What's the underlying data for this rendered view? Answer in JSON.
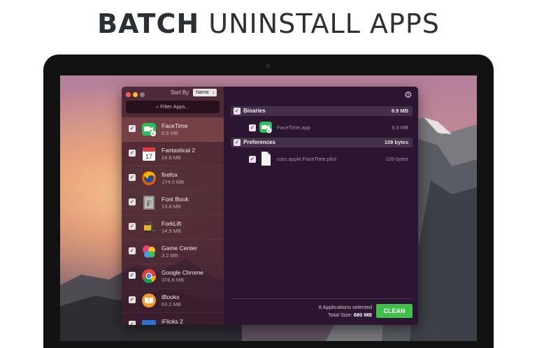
{
  "headline": {
    "bold": "BATCH",
    "rest": "UNINSTALL APPS"
  },
  "window": {
    "traffic_colors": [
      "#ff5f57",
      "#febc2e",
      "#8a7a80"
    ],
    "sort_label": "Sort By",
    "sort_value": "Name",
    "filter_placeholder": "Filter Apps..."
  },
  "apps": [
    {
      "name": "FaceTime",
      "size": "8.9 MB",
      "icon": "facetime-icon",
      "checked": true,
      "selected": true
    },
    {
      "name": "Fantastical 2",
      "size": "24.8 MB",
      "icon": "calendar-icon",
      "checked": true,
      "calendar_day": "17"
    },
    {
      "name": "firefox",
      "size": "174.5 MB",
      "icon": "firefox-icon",
      "checked": true
    },
    {
      "name": "Font Book",
      "size": "13.8 MB",
      "icon": "fontbook-icon",
      "checked": true,
      "letter": "F"
    },
    {
      "name": "ForkLift",
      "size": "14.9 MB",
      "icon": "forklift-icon",
      "checked": true
    },
    {
      "name": "Game Center",
      "size": "3.2 MB",
      "icon": "gamecenter-icon",
      "checked": true
    },
    {
      "name": "Google Chrome",
      "size": "376.6 MB",
      "icon": "chrome-icon",
      "checked": true
    },
    {
      "name": "iBooks",
      "size": "63.2 MB",
      "icon": "ibooks-icon",
      "checked": true
    },
    {
      "name": "iFlicks 2",
      "size": "",
      "icon": "iflicks-icon",
      "checked": true
    }
  ],
  "details": {
    "sections": [
      {
        "label": "Binaries",
        "value": "8.9 MB",
        "items": [
          {
            "label": "FaceTime.app",
            "value": "8.9 MB",
            "icon": "facetime-icon"
          }
        ]
      },
      {
        "label": "Preferences",
        "value": "109 bytes",
        "items": [
          {
            "label": "com.apple.FaceTime.plist",
            "value": "109 bytes",
            "icon": "file-icon"
          }
        ]
      }
    ],
    "selected_count": "8 Applications selected",
    "total_label": "Total Size:",
    "total_value": "680 MB",
    "clean_label": "CLEAN"
  },
  "colors": {
    "accent_green": "#3fbf4a",
    "selected_row": "#a05a5a"
  }
}
